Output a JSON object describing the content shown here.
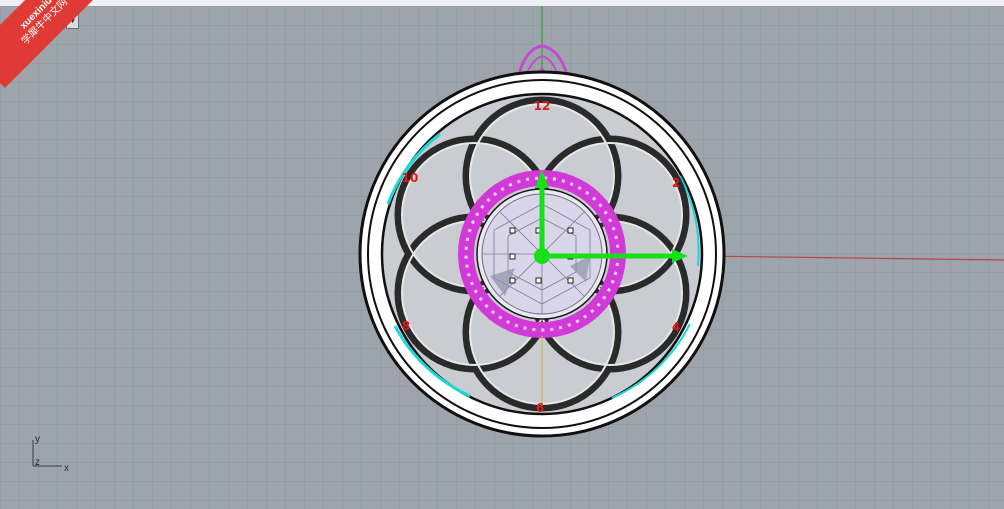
{
  "viewport": {
    "title": "Perspective",
    "title_visible": "ive",
    "dropdown_icon": "triangle-down-icon"
  },
  "watermark": {
    "line1": "xuexiniu",
    "line2": "学犀牛中文网"
  },
  "axis_indicator": {
    "y_label": "y",
    "z_label": "z",
    "x_label": "x"
  },
  "clock_numerals": [
    "12",
    "2",
    "4",
    "6",
    "8",
    "10"
  ],
  "colors": {
    "grid_background": "#9da4ac",
    "grid_line": "#8a9199",
    "x_axis": "#b04848",
    "y_axis": "#3aa13a",
    "gem_ring": "#d23ad8",
    "hands": "#18e018",
    "numerals": "#e01818",
    "accent_cyan": "#19d9d9"
  }
}
